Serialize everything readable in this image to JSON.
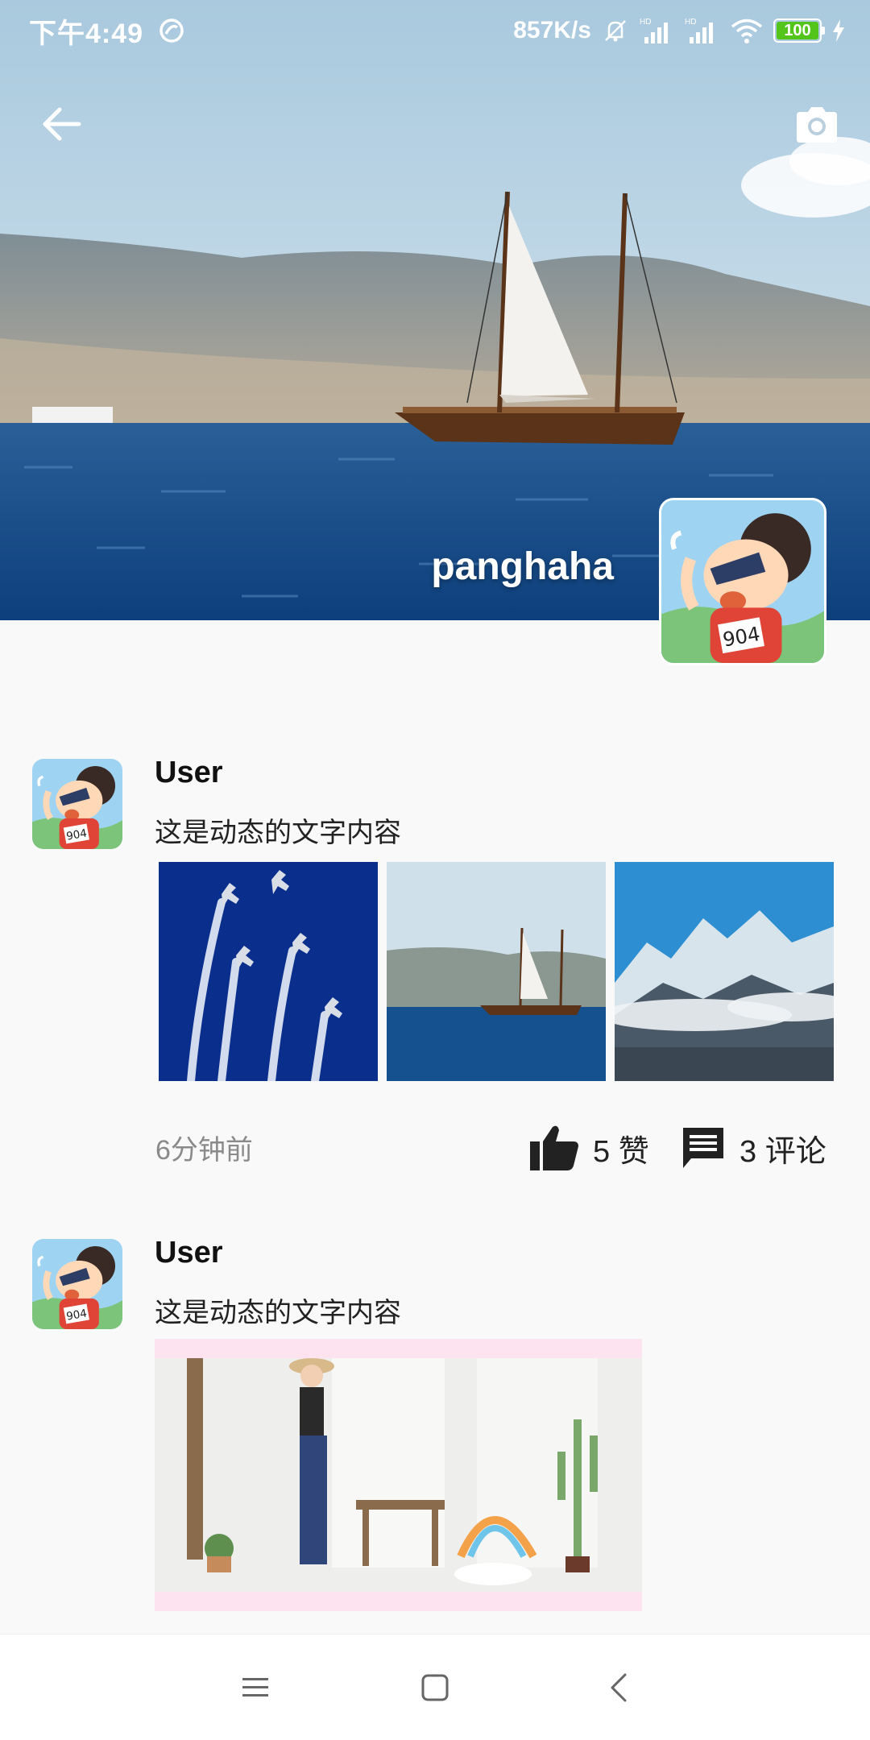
{
  "status_bar": {
    "time": "下午4:49",
    "net_speed": "857K/s",
    "battery_level": "100",
    "battery_fill_percent": 100,
    "icons": [
      "sync-icon",
      "mute-bell-icon",
      "hd-signal-icon",
      "hd-signal-icon",
      "wifi-icon",
      "battery-icon",
      "charging-icon"
    ]
  },
  "header": {
    "back_icon": "arrow-left-icon",
    "camera_icon": "camera-icon",
    "cover_image": "sailboat-on-sea"
  },
  "profile": {
    "username": "panghaha",
    "avatar": "cartoon-avatar"
  },
  "feed": [
    {
      "username": "User",
      "text": "这是动态的文字内容",
      "images": [
        "planes-formation",
        "sailboat-on-sea",
        "snowy-mountains"
      ],
      "time": "6分钟前",
      "likes": "5 赞",
      "comments": "3 评论"
    },
    {
      "username": "User",
      "text": "这是动态的文字内容",
      "video_thumbnail": "woman-in-room"
    }
  ],
  "nav_bar": {
    "menu_icon": "menu-icon",
    "home_icon": "home-square-icon",
    "back_icon": "back-chevron-icon"
  },
  "colors": {
    "accent_battery": "#52c41a",
    "background": "#f9f9f9",
    "sea": "#134a8c",
    "sky": "#c5dcea"
  }
}
